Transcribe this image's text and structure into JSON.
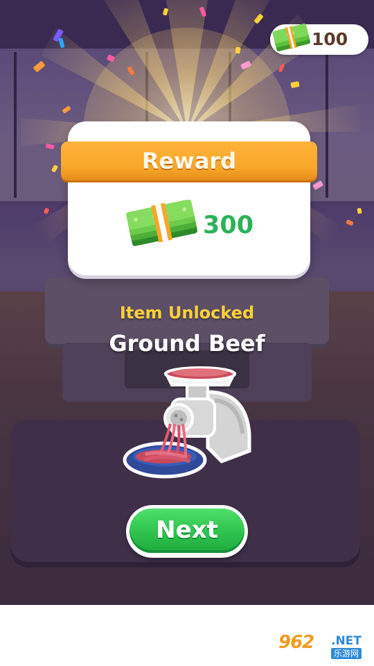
{
  "top_bar": {
    "currency_icon": "cash-stack-icon",
    "currency_value": "100"
  },
  "reward_popup": {
    "title": "Reward",
    "cash_icon": "cash-stack-icon",
    "amount": "300"
  },
  "unlock": {
    "label": "Item Unlocked",
    "item_name": "Ground Beef",
    "item_image": "meat-grinder-icon"
  },
  "actions": {
    "next_label": "Next"
  },
  "watermark": {
    "main": "962",
    "net": ".NET",
    "sub": "乐游网"
  },
  "colors": {
    "reward_banner": "#f7a628",
    "reward_amount": "#2cb25a",
    "unlock_label": "#ffd23a",
    "next_button": "#2fc24e",
    "currency_text": "#5b3a2a"
  }
}
